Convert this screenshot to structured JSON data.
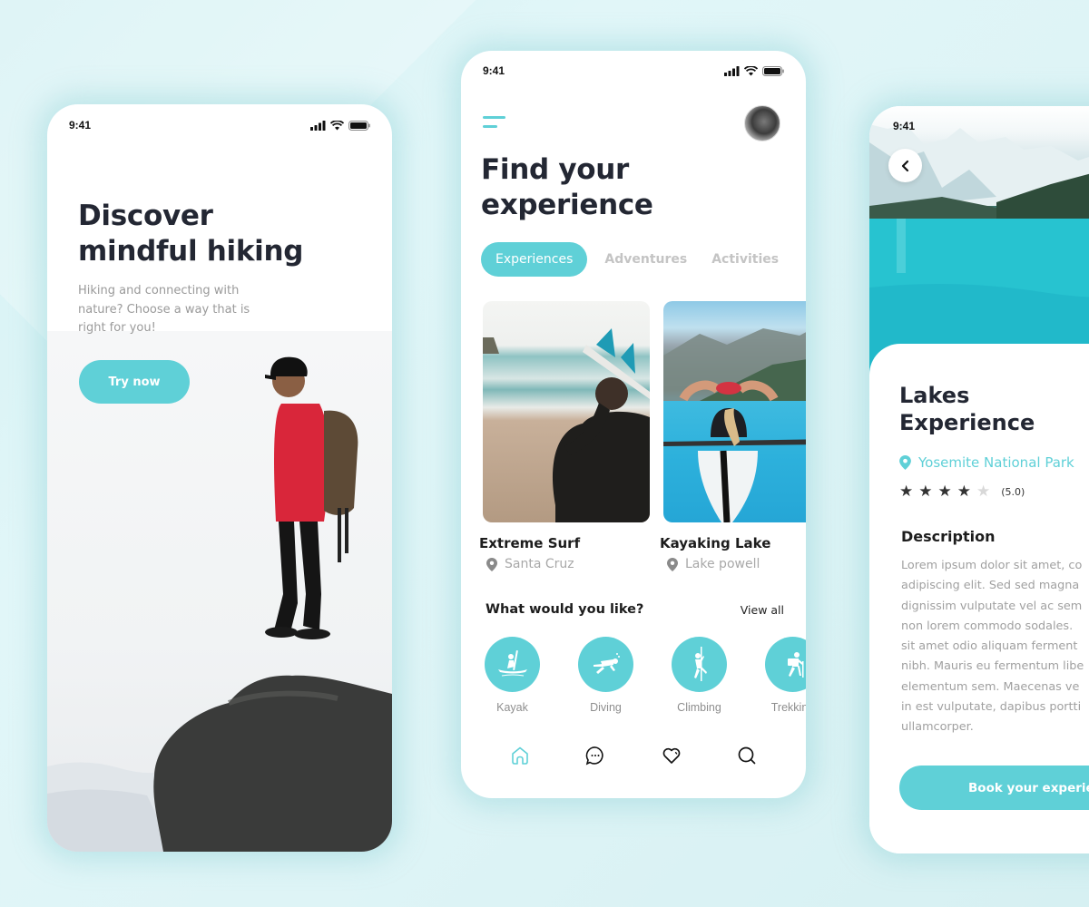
{
  "theme": {
    "accent": "#5fd0d7",
    "text_dark": "#232733",
    "text_muted": "#a0a0a0",
    "star_filled": "#333333",
    "star_empty": "#d8d8d8"
  },
  "statusbar": {
    "time": "9:41"
  },
  "onboarding": {
    "title_line1": "Discover",
    "title_line2": "mindful hiking",
    "subtitle": "Hiking and connecting with nature? Choose a way that is right for you!",
    "cta_label": "Try now",
    "image": "hiker-on-rock-photo"
  },
  "explore": {
    "title_line1": "Find your",
    "title_line2": "experience",
    "tabs": [
      {
        "label": "Experiences",
        "active": true
      },
      {
        "label": "Adventures",
        "active": false
      },
      {
        "label": "Activities",
        "active": false
      }
    ],
    "cards": [
      {
        "title": "Extreme Surf",
        "location": "Santa Cruz",
        "image": "surfer-on-beach-photo"
      },
      {
        "title": "Kayaking Lake",
        "location": "Lake powell",
        "image": "kayaker-on-lake-photo"
      }
    ],
    "section_title": "What would you like?",
    "view_all_label": "View all",
    "categories": [
      {
        "label": "Kayak",
        "icon": "kayak-icon"
      },
      {
        "label": "Diving",
        "icon": "diving-icon"
      },
      {
        "label": "Climbing",
        "icon": "climbing-icon"
      },
      {
        "label": "Trekking",
        "icon": "trekking-icon"
      }
    ],
    "bottom_nav": [
      {
        "name": "home",
        "icon": "home-icon",
        "active": true
      },
      {
        "name": "messages",
        "icon": "chat-icon",
        "active": false
      },
      {
        "name": "favorites",
        "icon": "heart-icon",
        "active": false
      },
      {
        "name": "search",
        "icon": "search-icon",
        "active": false
      }
    ]
  },
  "detail": {
    "title_line1": "Lakes",
    "title_line2": "Experience",
    "location": "Yosemite National Park",
    "rating_stars": 4,
    "rating_max": 5,
    "rating_label": "(5.0)",
    "description_heading": "Description",
    "description_lines": [
      "Lorem ipsum dolor sit amet, co",
      "adipiscing elit. Sed sed magna",
      "dignissim vulputate vel ac sem",
      "non lorem commodo sodales.",
      "sit amet odio aliquam ferment",
      "nibh. Mauris eu fermentum libe",
      "elementum sem. Maecenas ve",
      "in est vulputate, dapibus portti",
      "ullamcorper."
    ],
    "cta_label": "Book your experience",
    "image": "mountain-lake-photo"
  }
}
